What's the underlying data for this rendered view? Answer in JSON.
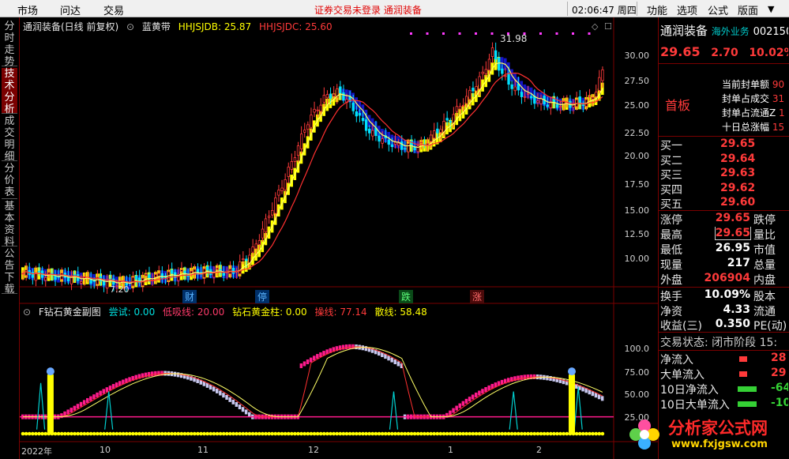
{
  "topbar": {
    "menu": [
      "市场",
      "问达",
      "交易"
    ],
    "notice": "证券交易未登录   通润装备",
    "clock": "02:06:47 周四",
    "right_menu": [
      "功能",
      "选项",
      "公式",
      "版面"
    ]
  },
  "side_tabs": [
    "分时走势",
    "技术分析",
    "成交明细",
    "分价表",
    "基本资料",
    "公告下载"
  ],
  "main_chart": {
    "stock_title": "通润装备(日线 前复权)",
    "indicator_name": "蓝黄带",
    "hhjsjdb_label": "HHJSJDB: 25.87",
    "hhjsjdc_label": "HHJSJDC: 25.60",
    "y_ticks": [
      "30.00",
      "27.50",
      "25.00",
      "22.50",
      "20.00",
      "17.50",
      "15.00",
      "12.50",
      "10.00"
    ],
    "high_label": "31.98",
    "low_label": "7.20",
    "event_marks": [
      "财",
      "停",
      "跌",
      "涨"
    ]
  },
  "sub_chart": {
    "title": "F钻石黄金副图",
    "legend": {
      "changshi": "尝试: 0.00",
      "dixi": "低吸线: 20.00",
      "zuanshi": "钻石黄金柱: 0.00",
      "caopan": "操线: 77.14",
      "sanxian": "散线: 58.48"
    },
    "y_ticks": [
      "100.0",
      "75.00",
      "50.00",
      "25.00"
    ],
    "x_ticks": [
      "2022年",
      "10",
      "11",
      "12",
      "1",
      "2"
    ]
  },
  "panel": {
    "name": "通润装备",
    "tag": "海外业务",
    "code": "002150",
    "price": "29.65",
    "change": "2.70",
    "pct": "10.02%",
    "board_label": "首板",
    "seal_rows": [
      {
        "label": "当前封单额",
        "value": "90"
      },
      {
        "label": "封单占成交",
        "value": "31"
      },
      {
        "label": "封单占流通Z",
        "value": "1"
      },
      {
        "label": "十日总涨幅",
        "value": "15"
      }
    ],
    "bids": [
      {
        "label": "买一",
        "price": "29.65"
      },
      {
        "label": "买二",
        "price": "29.64"
      },
      {
        "label": "买三",
        "price": "29.63"
      },
      {
        "label": "买四",
        "price": "29.62"
      },
      {
        "label": "买五",
        "price": "29.60"
      }
    ],
    "stats_left": [
      {
        "label": "涨停",
        "value": "29.65"
      },
      {
        "label": "最高",
        "value": "29.65"
      },
      {
        "label": "最低",
        "value": "26.95"
      },
      {
        "label": "现量",
        "value": "217"
      },
      {
        "label": "外盘",
        "value": "206904"
      }
    ],
    "stats_right": [
      "跌停",
      "量比",
      "市值",
      "总量",
      "内盘"
    ],
    "stats2": [
      {
        "label": "换手",
        "value": "10.09%",
        "right": "股本"
      },
      {
        "label": "净资",
        "value": "4.33",
        "right": "流通"
      },
      {
        "label": "收益(三)",
        "value": "0.350",
        "right": "PE(动)"
      }
    ],
    "trade_status": "交易状态: 闭市阶段 15:",
    "flows": [
      {
        "label": "净流入",
        "value": "28"
      },
      {
        "label": "大单流入",
        "value": "29"
      },
      {
        "label": "10日净流入",
        "value": "-64"
      },
      {
        "label": "10日大单流入",
        "value": "-10"
      }
    ]
  },
  "watermark": {
    "title": "分析家公式网",
    "url": "www.fxjgsw.com"
  },
  "colors": {
    "up": "#ff3a3a",
    "down": "#35d035",
    "yellow_band": "#ffff00",
    "blue_band": "#1515c8",
    "pink_bar": "#ff1a8c",
    "lavender_bar": "#c8c8f0"
  }
}
